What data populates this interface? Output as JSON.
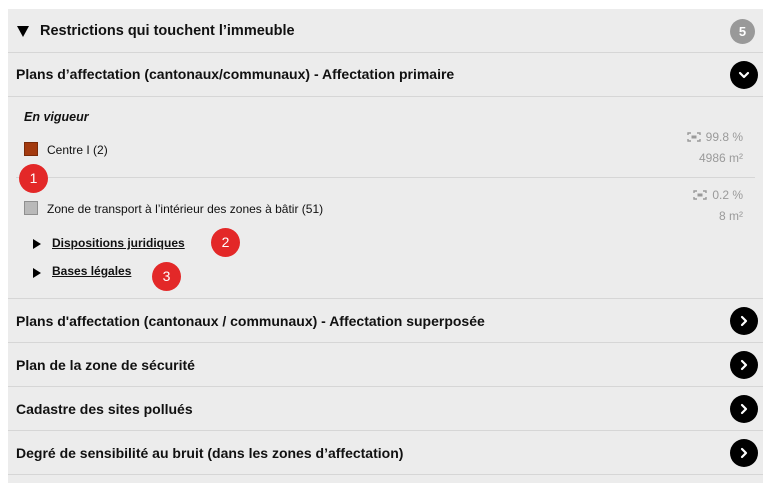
{
  "header": {
    "title": "Restrictions qui touchent l’immeuble",
    "count": "5"
  },
  "primary": {
    "title": "Plans d’affectation (cantonaux/communaux) - Affectation primaire",
    "status": "En vigueur",
    "items": [
      {
        "label": "Centre I (2)",
        "color": "#a33a0f",
        "percent": "99.8 %",
        "area": "4986 m²"
      },
      {
        "label": "Zone de transport à l’intérieur des zones à bâtir (51)",
        "color": "#b9b9b9",
        "percent": "0.2 %",
        "area": "8 m²"
      }
    ],
    "links": [
      {
        "label": "Dispositions juridiques"
      },
      {
        "label": "Bases légales"
      }
    ]
  },
  "badges": [
    "1",
    "2",
    "3"
  ],
  "sections": [
    {
      "title": "Plans d'affectation (cantonaux / communaux) - Affectation superposée"
    },
    {
      "title": "Plan de la zone de sécurité"
    },
    {
      "title": "Cadastre des sites pollués"
    },
    {
      "title": "Degré de sensibilité au bruit (dans les zones d’affectation)"
    }
  ],
  "icons": {
    "collapse": "chevron-down-icon",
    "expand": "chevron-right-icon",
    "area": "area-measure-icon"
  },
  "colors": {
    "accent": "#000000",
    "badge": "#e32828",
    "muted": "#9a9a9a"
  }
}
